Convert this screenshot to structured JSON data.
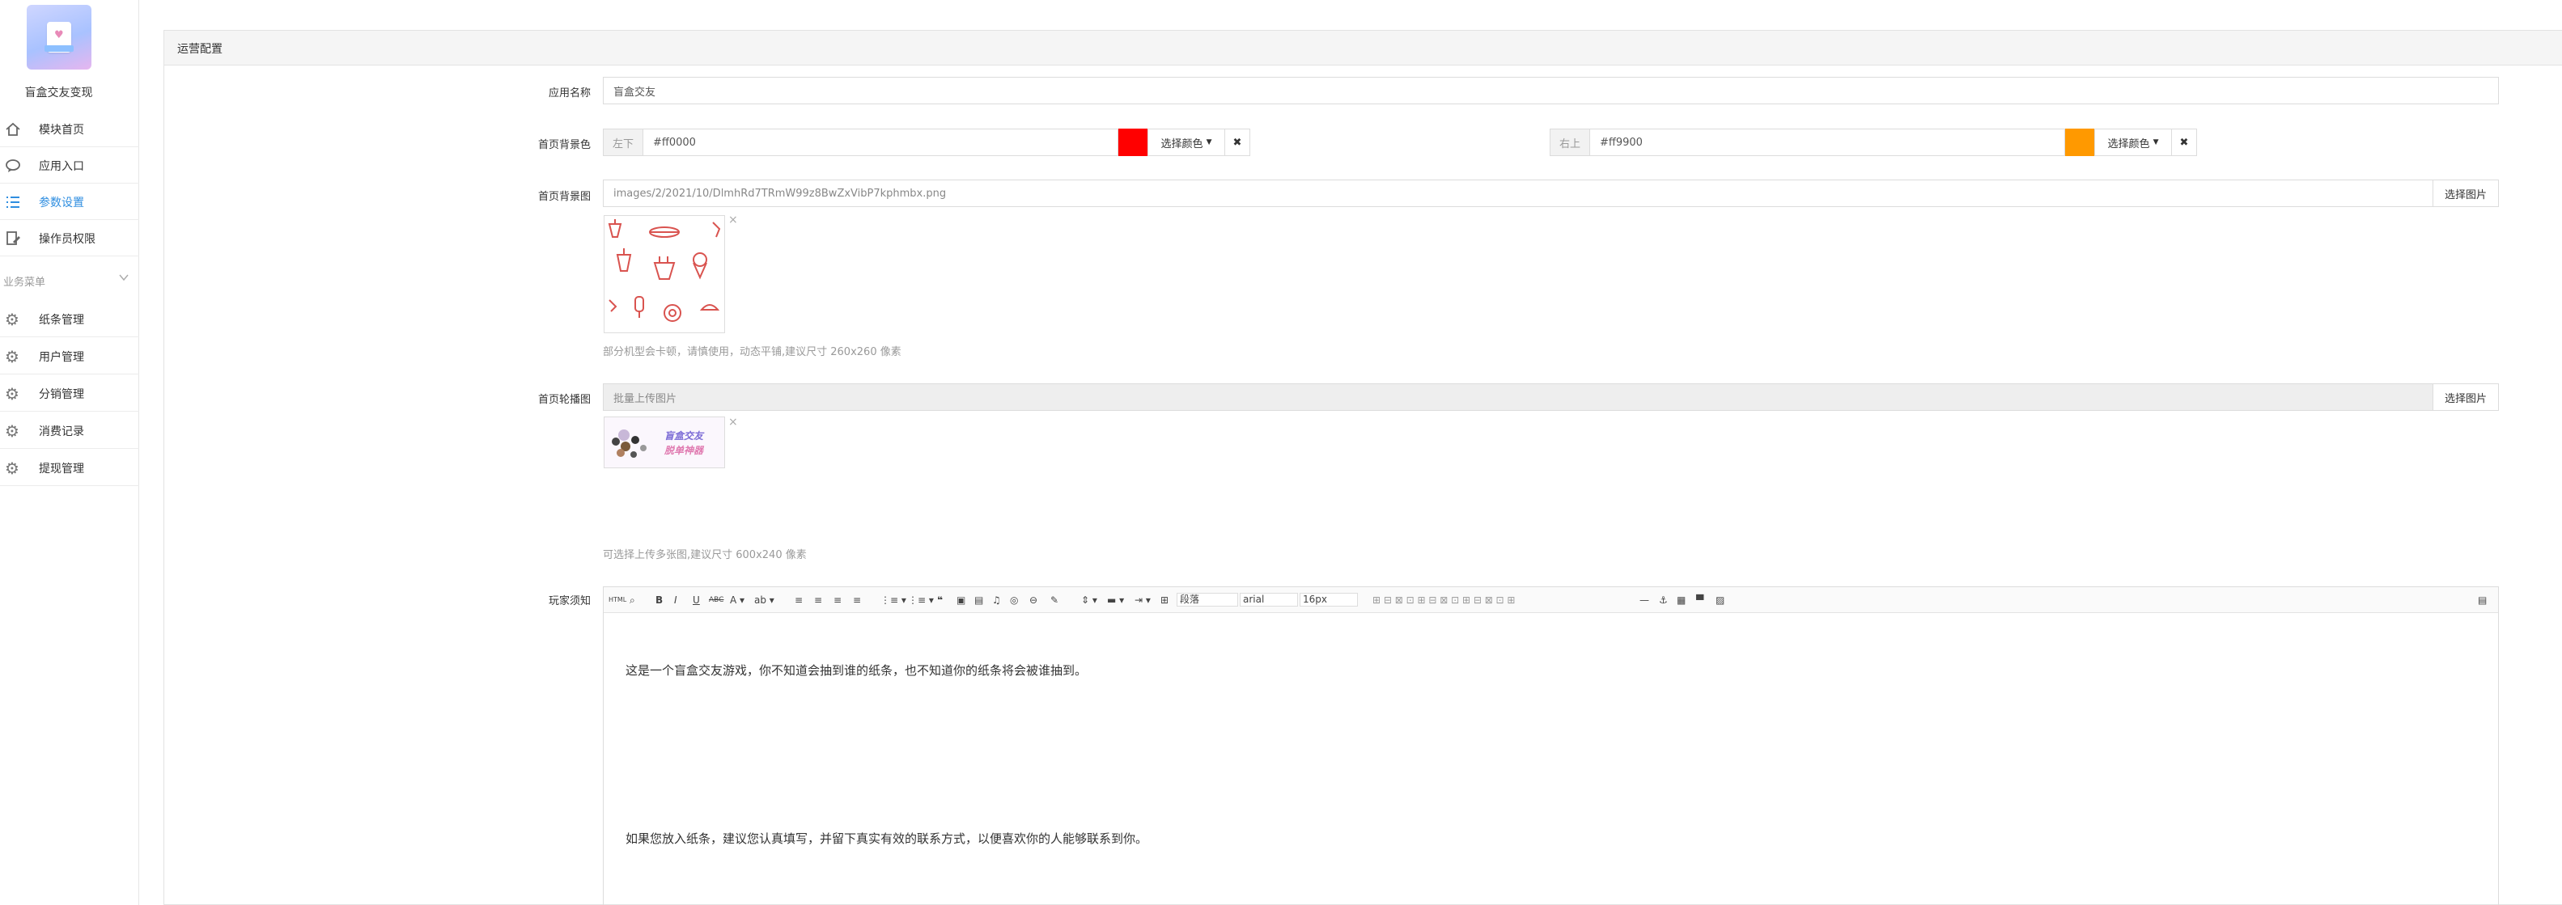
{
  "sidebar": {
    "app_name": "盲盒交友变现",
    "items": [
      {
        "label": "模块首页",
        "icon": "home-icon"
      },
      {
        "label": "应用入口",
        "icon": "chat-icon"
      },
      {
        "label": "参数设置",
        "icon": "list-settings-icon",
        "active": true
      },
      {
        "label": "操作员权限",
        "icon": "edit-doc-icon"
      }
    ],
    "group_label": "业务菜单",
    "group_items": [
      {
        "label": "纸条管理",
        "icon": "gear-icon"
      },
      {
        "label": "用户管理",
        "icon": "gear-icon"
      },
      {
        "label": "分销管理",
        "icon": "gear-icon"
      },
      {
        "label": "消费记录",
        "icon": "gear-icon"
      },
      {
        "label": "提现管理",
        "icon": "gear-icon"
      }
    ]
  },
  "panel": {
    "title": "运营配置",
    "app_name_field": {
      "label": "应用名称",
      "value": "盲盒交友"
    },
    "bg_color": {
      "label": "首页背景色",
      "left": {
        "addon": "左下",
        "value": "#ff0000",
        "color": "#ff0000",
        "button": "选择颜色",
        "clear": "✖"
      },
      "right": {
        "addon": "右上",
        "value": "#ff9900",
        "color": "#ff9900",
        "button": "选择颜色",
        "clear": "✖"
      }
    },
    "bg_image": {
      "label": "首页背景图",
      "value": "images/2/2021/10/DlmhRd7TRmW99z8BwZxVibP7kphmbx.png",
      "button": "选择图片",
      "remove": "×",
      "help": "部分机型会卡顿，请慎使用，动态平铺,建议尺寸 260x260 像素"
    },
    "carousel": {
      "label": "首页轮播图",
      "placeholder": "批量上传图片",
      "button": "选择图片",
      "remove": "×",
      "thumb_text_1": "盲盒交友",
      "thumb_text_2": "脱单神器",
      "help": "可选择上传多张图,建议尺寸 600x240 像素"
    },
    "notice": {
      "label": "玩家须知",
      "toolbar": {
        "html": "HTML",
        "para": "段落",
        "font": "arial",
        "size": "16px"
      },
      "line1": "这是一个盲盒交友游戏，你不知道会抽到谁的纸条，也不知道你的纸条将会被谁抽到。",
      "line2": "如果您放入纸条，建议您认真填写，并留下真实有效的联系方式，以便喜欢你的人能够联系到你。"
    }
  }
}
